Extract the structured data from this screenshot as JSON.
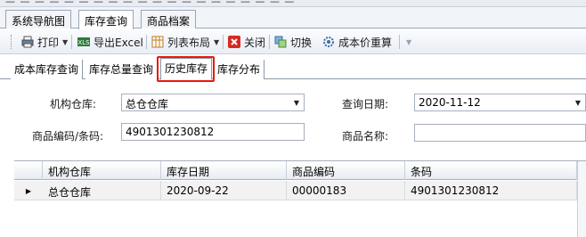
{
  "doc_tabs": [
    {
      "label": "系统导航图",
      "active": false
    },
    {
      "label": "库存查询",
      "active": true
    },
    {
      "label": "商品档案",
      "active": false
    }
  ],
  "toolbar": {
    "print_label": "打印",
    "export_label": "导出Excel",
    "layout_label": "列表布局",
    "close_label": "关闭",
    "switch_label": "切换",
    "recalc_label": "成本价重算"
  },
  "sub_tabs": [
    {
      "label": "成本库存查询",
      "active": false
    },
    {
      "label": "库存总量查询",
      "active": false
    },
    {
      "label": "历史库存",
      "active": true
    },
    {
      "label": "库存分布",
      "active": false
    }
  ],
  "form": {
    "warehouse_label": "机构仓库:",
    "warehouse_value": "总仓仓库",
    "date_label": "查询日期:",
    "date_value": "2020-11-12",
    "code_label": "商品编码/条码:",
    "code_value": "4901301230812",
    "name_label": "商品名称:",
    "name_value": ""
  },
  "grid": {
    "columns": [
      "机构仓库",
      "库存日期",
      "商品编码",
      "条码"
    ],
    "rows": [
      [
        "总仓仓库",
        "2020-09-22",
        "00000183",
        "4901301230812"
      ]
    ]
  },
  "colors": {
    "highlight_border": "#e8190c",
    "selected_row_bg": "#f2f2f2"
  }
}
